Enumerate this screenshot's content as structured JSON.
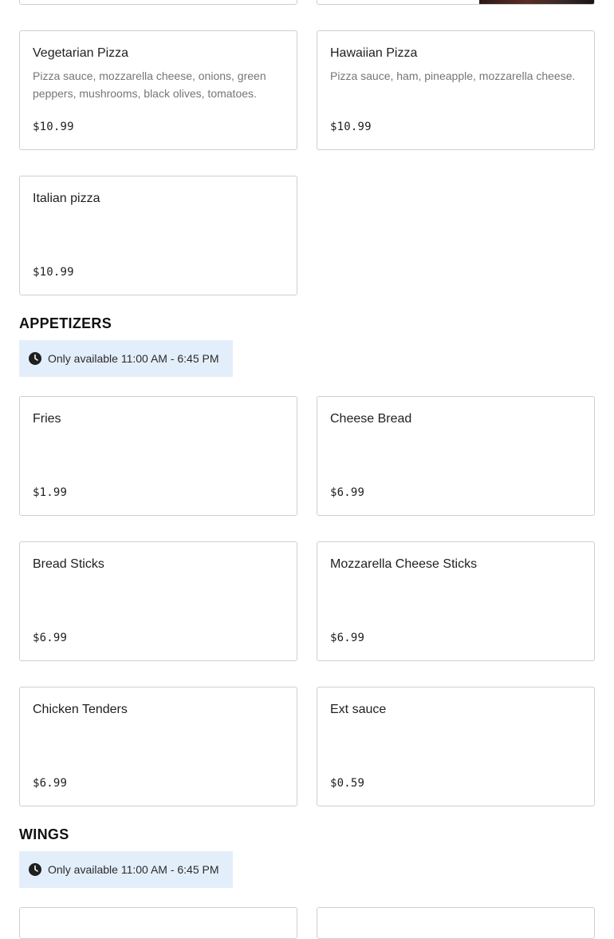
{
  "pizza": {
    "items": [
      {
        "name": "Vegetarian Pizza",
        "description": "Pizza sauce, mozzarella cheese, onions, green peppers, mushrooms, black olives, tomatoes.",
        "price": "$10.99"
      },
      {
        "name": "Hawaiian Pizza",
        "description": "Pizza sauce, ham, pineapple, mozzarella cheese.",
        "price": "$10.99"
      },
      {
        "name": "Italian pizza",
        "description": "",
        "price": "$10.99"
      }
    ]
  },
  "appetizers": {
    "title": "APPETIZERS",
    "availability": "Only available 11:00 AM - 6:45 PM",
    "items": [
      {
        "name": "Fries",
        "price": "$1.99"
      },
      {
        "name": "Cheese Bread",
        "price": "$6.99"
      },
      {
        "name": "Bread Sticks",
        "price": "$6.99"
      },
      {
        "name": "Mozzarella Cheese Sticks",
        "price": "$6.99"
      },
      {
        "name": "Chicken Tenders",
        "price": "$6.99"
      },
      {
        "name": "Ext sauce",
        "price": "$0.59"
      }
    ]
  },
  "wings": {
    "title": "WINGS",
    "availability": "Only available 11:00 AM - 6:45 PM"
  },
  "icons": {
    "availability": "clock-icon"
  },
  "colors": {
    "availability_bg": "#e3eefb",
    "card_border": "#cfcfcf",
    "description_text": "#767676"
  }
}
